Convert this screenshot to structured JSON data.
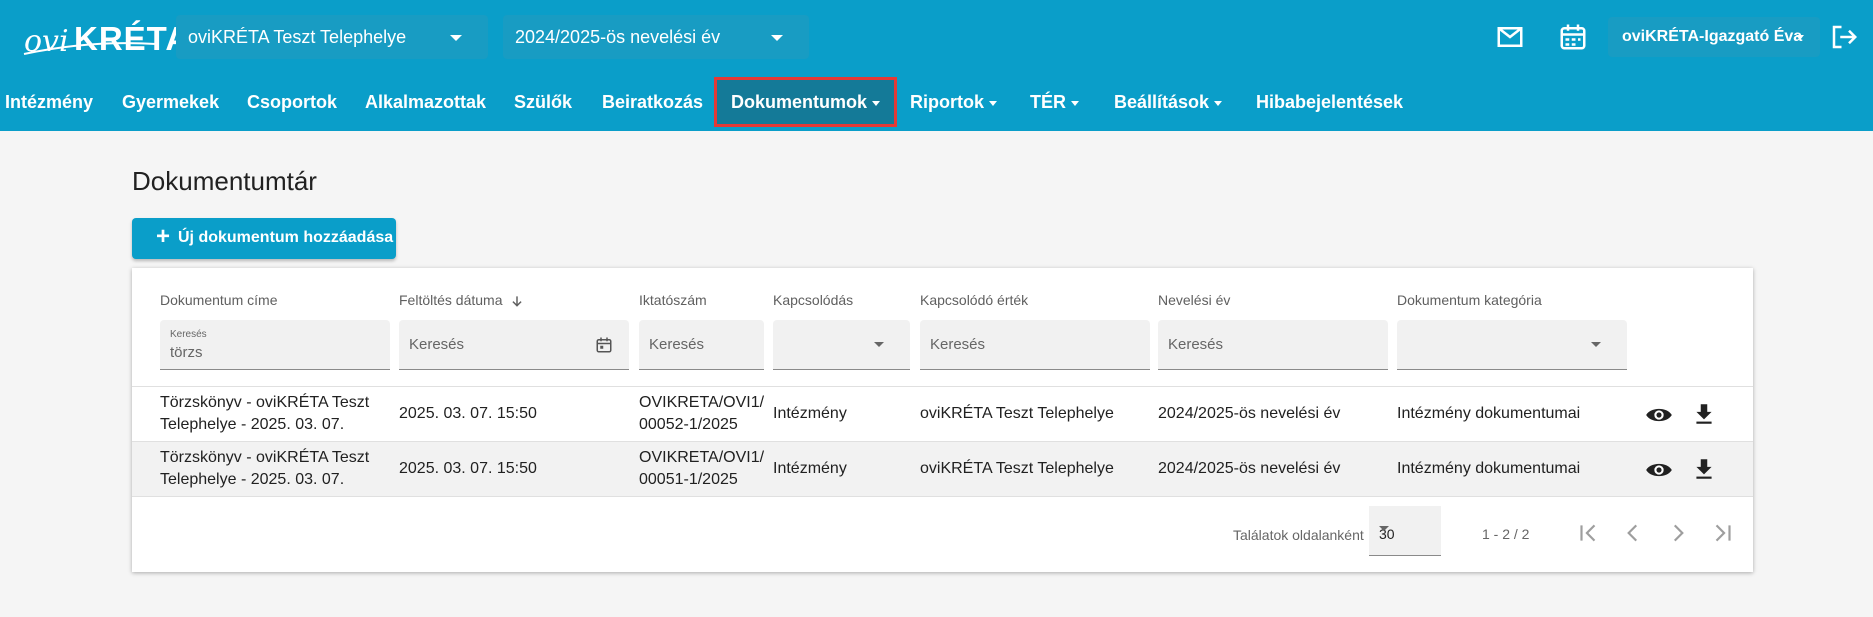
{
  "header": {
    "logo_prefix": "ovi",
    "logo_main": "KRÉTA",
    "site_select": "oviKRÉTA Teszt Telephelye",
    "year_select": "2024/2025-ös nevelési év",
    "user_name": "oviKRÉTA-Igazgató Éva"
  },
  "nav": {
    "items": [
      {
        "label": "Intézmény"
      },
      {
        "label": "Gyermekek"
      },
      {
        "label": "Csoportok"
      },
      {
        "label": "Alkalmazottak"
      },
      {
        "label": "Szülők"
      },
      {
        "label": "Beiratkozás"
      },
      {
        "label": "Dokumentumok",
        "active": true
      },
      {
        "label": "Riportok"
      },
      {
        "label": "TÉR"
      },
      {
        "label": "Beállítások"
      },
      {
        "label": "Hibabejelentések"
      }
    ]
  },
  "page": {
    "title": "Dokumentumtár",
    "add_button": "Új dokumentum hozzáadása"
  },
  "table": {
    "columns": [
      "Dokumentum címe",
      "Feltöltés dátuma",
      "Iktatószám",
      "Kapcsolódás",
      "Kapcsolódó érték",
      "Nevelési év",
      "Dokumentum kategória"
    ],
    "filters": {
      "title_label": "Keresés",
      "title_value": "törzs",
      "placeholder": "Keresés"
    },
    "rows": [
      {
        "title_line1": "Törzskönyv - oviKRÉTA Teszt",
        "title_line2": "Telephelye - 2025. 03. 07.",
        "date": "2025. 03. 07. 15:50",
        "reg_line1": "OVIKRETA/OVI1/",
        "reg_line2": "00052-1/2025",
        "link": "Intézmény",
        "link_value": "oviKRÉTA Teszt Telephelye",
        "year": "2024/2025-ös nevelési év",
        "category": "Intézmény dokumentumai"
      },
      {
        "title_line1": "Törzskönyv - oviKRÉTA Teszt",
        "title_line2": "Telephelye - 2025. 03. 07.",
        "date": "2025. 03. 07. 15:50",
        "reg_line1": "OVIKRETA/OVI1/",
        "reg_line2": "00051-1/2025",
        "link": "Intézmény",
        "link_value": "oviKRÉTA Teszt Telephelye",
        "year": "2024/2025-ös nevelési év",
        "category": "Intézmény dokumentumai"
      }
    ]
  },
  "pagination": {
    "per_page_label": "Találatok oldalanként",
    "per_page_value": "30",
    "range": "1 - 2 / 2"
  },
  "colors": {
    "brand": "#0a9ec9",
    "active_nav": "#147a98",
    "highlight": "#e53935"
  }
}
